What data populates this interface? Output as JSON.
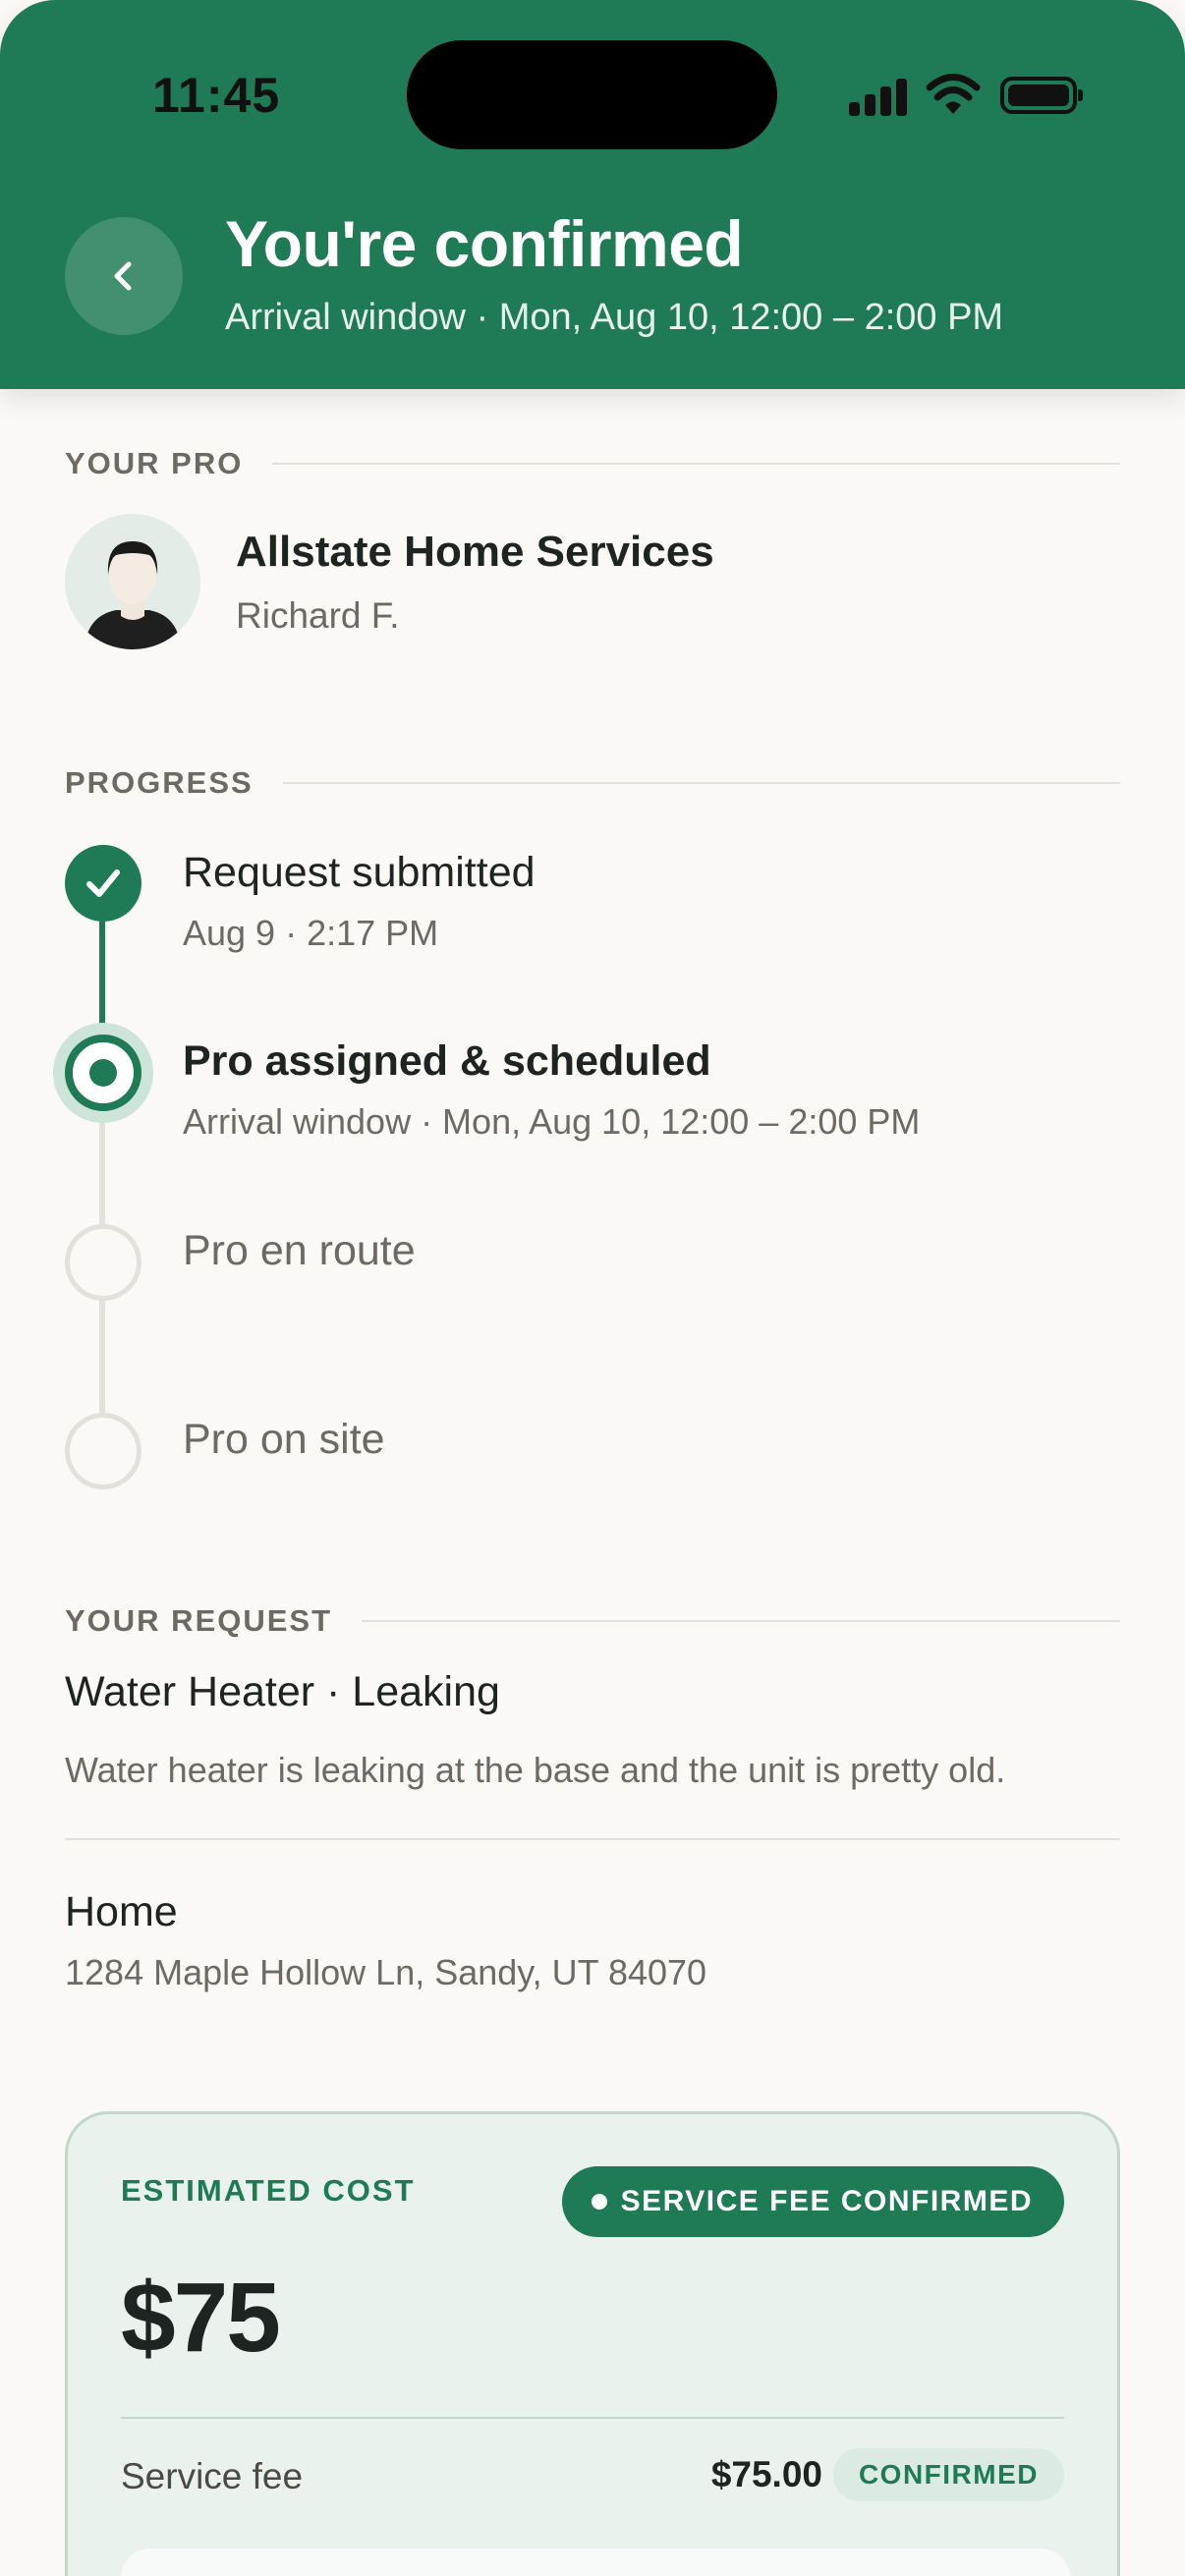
{
  "status_bar": {
    "time": "11:45"
  },
  "header": {
    "title": "You're confirmed",
    "subtitle": "Arrival window · Mon, Aug 10, 12:00 – 2:00 PM"
  },
  "pro_section": {
    "label": "YOUR PRO",
    "company": "Allstate Home Services",
    "person": "Richard F."
  },
  "progress": {
    "label": "PROGRESS",
    "steps": [
      {
        "title": "Request submitted",
        "sub": "Aug 9 · 2:17 PM",
        "state": "done"
      },
      {
        "title": "Pro assigned & scheduled",
        "sub": "Arrival window · Mon, Aug 10, 12:00 – 2:00 PM",
        "state": "current"
      },
      {
        "title": "Pro en route",
        "sub": "",
        "state": "todo"
      },
      {
        "title": "Pro on site",
        "sub": "",
        "state": "todo"
      }
    ]
  },
  "request": {
    "label": "YOUR REQUEST",
    "title": "Water Heater · Leaking",
    "description": "Water heater is leaking at the base and the unit is pretty old.",
    "location_label": "Home",
    "address": "1284 Maple Hollow Ln, Sandy, UT 84070"
  },
  "cost": {
    "label": "ESTIMATED COST",
    "badge": "SERVICE FEE CONFIRMED",
    "amount": "$75",
    "line_items": [
      {
        "label": "Service fee",
        "amount": "$75.00",
        "status": "CONFIRMED"
      }
    ]
  },
  "colors": {
    "brand": "#1E7B55",
    "background": "#FAF9F6",
    "muted": "#6F6A61"
  },
  "icons": {
    "back": "chevron-left-icon",
    "step_done": "check-icon"
  }
}
